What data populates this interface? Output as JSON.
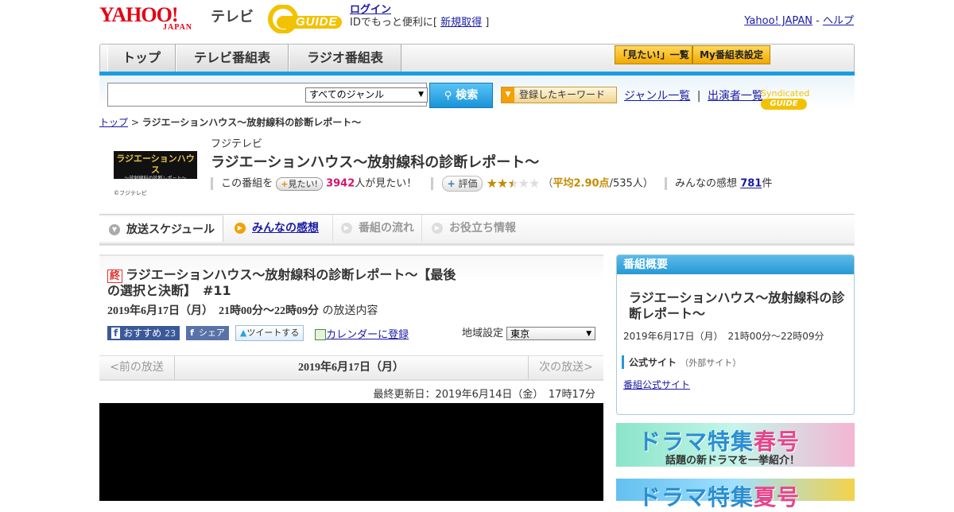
{
  "header": {
    "yahoo_logo_text": "YAHOO!",
    "yahoo_logo_sub": "JAPAN",
    "tv_label": "テレビ",
    "gguide_logo_text": "GUIDE",
    "login_label": "ログイン",
    "login_prompt": "IDでもっと便利に[",
    "signup_label": "新規取得",
    "login_suffix": "]",
    "yahoo_japan_link": "Yahoo! JAPAN",
    "link_separator": "-",
    "help_link": "ヘルプ"
  },
  "nav": {
    "tabs": [
      {
        "label": "トップ"
      },
      {
        "label": "テレビ番組表"
      },
      {
        "label": "ラジオ番組表"
      }
    ],
    "mitai_list_label": "「見たい!」一覧",
    "my_schedule_label": "My番組表設定"
  },
  "search": {
    "input_value": "",
    "genre_selected": "すべてのジャンル",
    "search_button": "検索",
    "keyword_button": "登録したキーワード",
    "genre_list_link": "ジャンル一覧",
    "link_separator": "|",
    "performer_list_link": "出演者一覧",
    "syndicated_label": "Syndicated"
  },
  "breadcrumb": {
    "top": "トップ",
    "separator": ">",
    "current": "ラジエーションハウス～放射線科の診断レポート～"
  },
  "program": {
    "thumb_text": "ラジエーションハウス",
    "thumb_sub": "～放射線科の診断レポート～",
    "copyright": "©フジテレビ",
    "station": "フジテレビ",
    "title": "ラジエーションハウス～放射線科の診断レポート～",
    "mitai_prefix": "この番組を",
    "mitai_button": "見たい!",
    "mitai_count": "3942",
    "mitai_suffix": "人が見たい！",
    "eval_button": "評価",
    "rating": 2.9,
    "rating_open": "（",
    "rating_label": "平均2.90点",
    "rating_votes": "/535人）",
    "review_prefix": "みんなの感想",
    "review_count": "781",
    "review_suffix": "件"
  },
  "subtabs": {
    "schedule": "放送スケジュール",
    "review": "みんなの感想",
    "flow": "番組の流れ",
    "info": "お役立ち情報"
  },
  "episode": {
    "end_badge": "終",
    "title": "ラジエーションハウス～放射線科の診断レポート～【最後の選択と決断】　#11",
    "date": "2019年6月17日（月）　21時00分～22時09分",
    "date_suffix": "の放送内容",
    "fb_recommend": "おすすめ",
    "fb_count": "23",
    "fb_share": "シェア",
    "tweet": "ツイートする",
    "calendar": "カレンダーに登録",
    "region_label": "地域設定",
    "region_value": "東京"
  },
  "pager": {
    "prev": "<前の放送",
    "current": "2019年6月17日（月）",
    "next": "次の放送>"
  },
  "last_update": "最終更新日：2019年6月14日（金）　17時17分",
  "sidebar": {
    "header": "番組概要",
    "title": "ラジエーションハウス～放射線科の診断レポート～",
    "date": "2019年6月17日（月）　21時00分～22時09分",
    "official_label": "公式サイト",
    "official_note": "（外部サイト）",
    "official_link": "番組公式サイト"
  },
  "banners": {
    "spring_main": "ドラマ特集",
    "spring_season": "春号",
    "spring_sub": "話題の新ドラマを一挙紹介！",
    "summer_main": "ドラマ特集",
    "summer_season": "夏号"
  },
  "colors": {
    "accent_blue": "#1a9de0",
    "link": "#1a1aa6",
    "mitai_pink": "#d4156b",
    "rating_gold": "#c48a00"
  }
}
